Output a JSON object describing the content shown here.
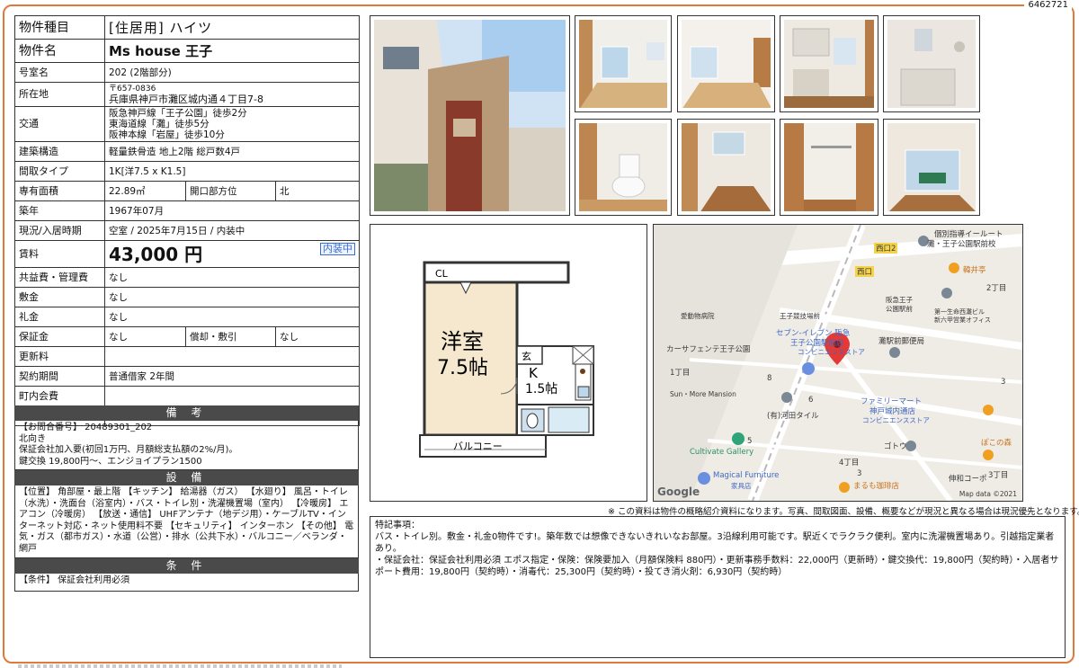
{
  "doc_id": "6462721",
  "spec": {
    "type_label": "物件種目",
    "type_value": "[住居用] ハイツ",
    "name_label": "物件名",
    "name_value": "Ms house 王子",
    "room_label": "号室名",
    "room_value": "202 (2階部分)",
    "addr_label": "所在地",
    "addr_zip": "〒657-0836",
    "addr_value": "兵庫県神戸市灘区城内通４丁目7-8",
    "traffic_label": "交通",
    "traffic_1": "阪急神戸線「王子公園」徒歩2分",
    "traffic_2": "東海道線「灘」徒歩5分",
    "traffic_3": "阪神本線「岩屋」徒歩10分",
    "struct_label": "建築構造",
    "struct_value": "軽量鉄骨造 地上2階 総戸数4戸",
    "layout_label": "間取タイプ",
    "layout_value": "1K[洋7.5 x K1.5]",
    "area_label": "専有面積",
    "area_value": "22.89㎡",
    "dir_label": "開口部方位",
    "dir_value": "北",
    "built_label": "築年",
    "built_value": "1967年07月",
    "status_label": "現況/入居時期",
    "status_value": "空室 / 2025年7月15日 / 内装中",
    "rent_label": "賃料",
    "rent_value": "43,000 円",
    "rent_badge": "内装中",
    "common_label": "共益費・管理費",
    "common_value": "なし",
    "deposit_label": "敷金",
    "deposit_value": "なし",
    "key_label": "礼金",
    "key_value": "なし",
    "guarantee_label": "保証金",
    "guarantee_value": "なし",
    "amort_label": "償却・敷引",
    "amort_value": "なし",
    "renew_label": "更新料",
    "renew_value": "",
    "contract_label": "契約期間",
    "contract_value": "普通借家 2年間",
    "town_label": "町内会費",
    "town_value": "",
    "parking_label": "駐車場",
    "parking_value": ""
  },
  "remarks": {
    "title": "備 考",
    "line1": "【お問合番号】 20489301_202",
    "line2": "北向き",
    "line3": "保証会社加入要(初回1万円、月額総支払額の2%/月)。",
    "line4": "鍵交換 19,800円〜、エンジョイプラン1500"
  },
  "equipment": {
    "title": "設 備",
    "text": "【位置】 角部屋・最上階 【キッチン】 給湯器（ガス） 【水廻り】 風呂・トイレ（水洗）・洗面台（浴室内）・バス・トイレ別・洗濯機置場（室内） 【冷暖房】 エアコン（冷暖房） 【放送・通信】 UHFアンテナ（地デジ用）・ケーブルTV・インターネット対応・ネット使用料不要 【セキュリティ】 インターホン 【その他】 電気・ガス（都市ガス）・水道（公営）・排水（公共下水）・バルコニー／ベランダ・網戸"
  },
  "conditions": {
    "title": "条 件",
    "text": "【条件】 保証会社利用必須"
  },
  "floorplan": {
    "cl": "CL",
    "western_room": "洋室",
    "western_size": "7.5帖",
    "entrance": "玄",
    "kitchen": "K",
    "kitchen_size": "1.5帖",
    "balcony": "バルコニー"
  },
  "map": {
    "labels": [
      "個別指導イールート",
      "灘・王子公園駅前校",
      "西口2",
      "西口",
      "韓井亭",
      "2丁目",
      "阪急王子",
      "公園駅前",
      "第一生命西灘ビル",
      "新六甲営業オフィス",
      "愛動物病院",
      "王子競技場前",
      "カーサフェンテ王子公園",
      "セブン-イレブン 阪急",
      "王子公園駅前店",
      "コンビニエンスストア",
      "灘駅前郵便局",
      "1丁目",
      "Sun・More Mansion",
      "8",
      "6",
      "(有)河田タイル",
      "ファミリーマート",
      "神戸城内通店",
      "コンビニエンスストア",
      "3",
      "Cultivate Gallery",
      "5",
      "ゴトウ",
      "ぽこの森",
      "Magical Furniture",
      "家具店",
      "4丁目",
      "3",
      "伸和コーポ",
      "3丁目",
      "まるも珈琲店"
    ],
    "google": "Google",
    "data": "Map data ©2021"
  },
  "note": "※ この資料は物件の概略紹介資料になります。写真、間取図面、設備、概要などが現況と異なる場合は現況優先となります。",
  "special": {
    "title": "特記事項：",
    "line1": "バス・トイレ別。敷金・礼金0物件です!。築年数では想像できないきれいなお部屋。3沿線利用可能です。駅近くでラクラク便利。室内に洗濯機置場あり。引越指定業者あり。",
    "line2": "・保証会社：保証会社利用必須 エポス指定・保険：保険要加入（月額保険料 880円）・更新事務手数料：22,000円（更新時）・鍵交換代：19,800円（契約時）・入居者サポート費用：19,800円（契約時）・消毒代：25,300円（契約時）・投てき消火剤：6,930円（契約時）"
  }
}
